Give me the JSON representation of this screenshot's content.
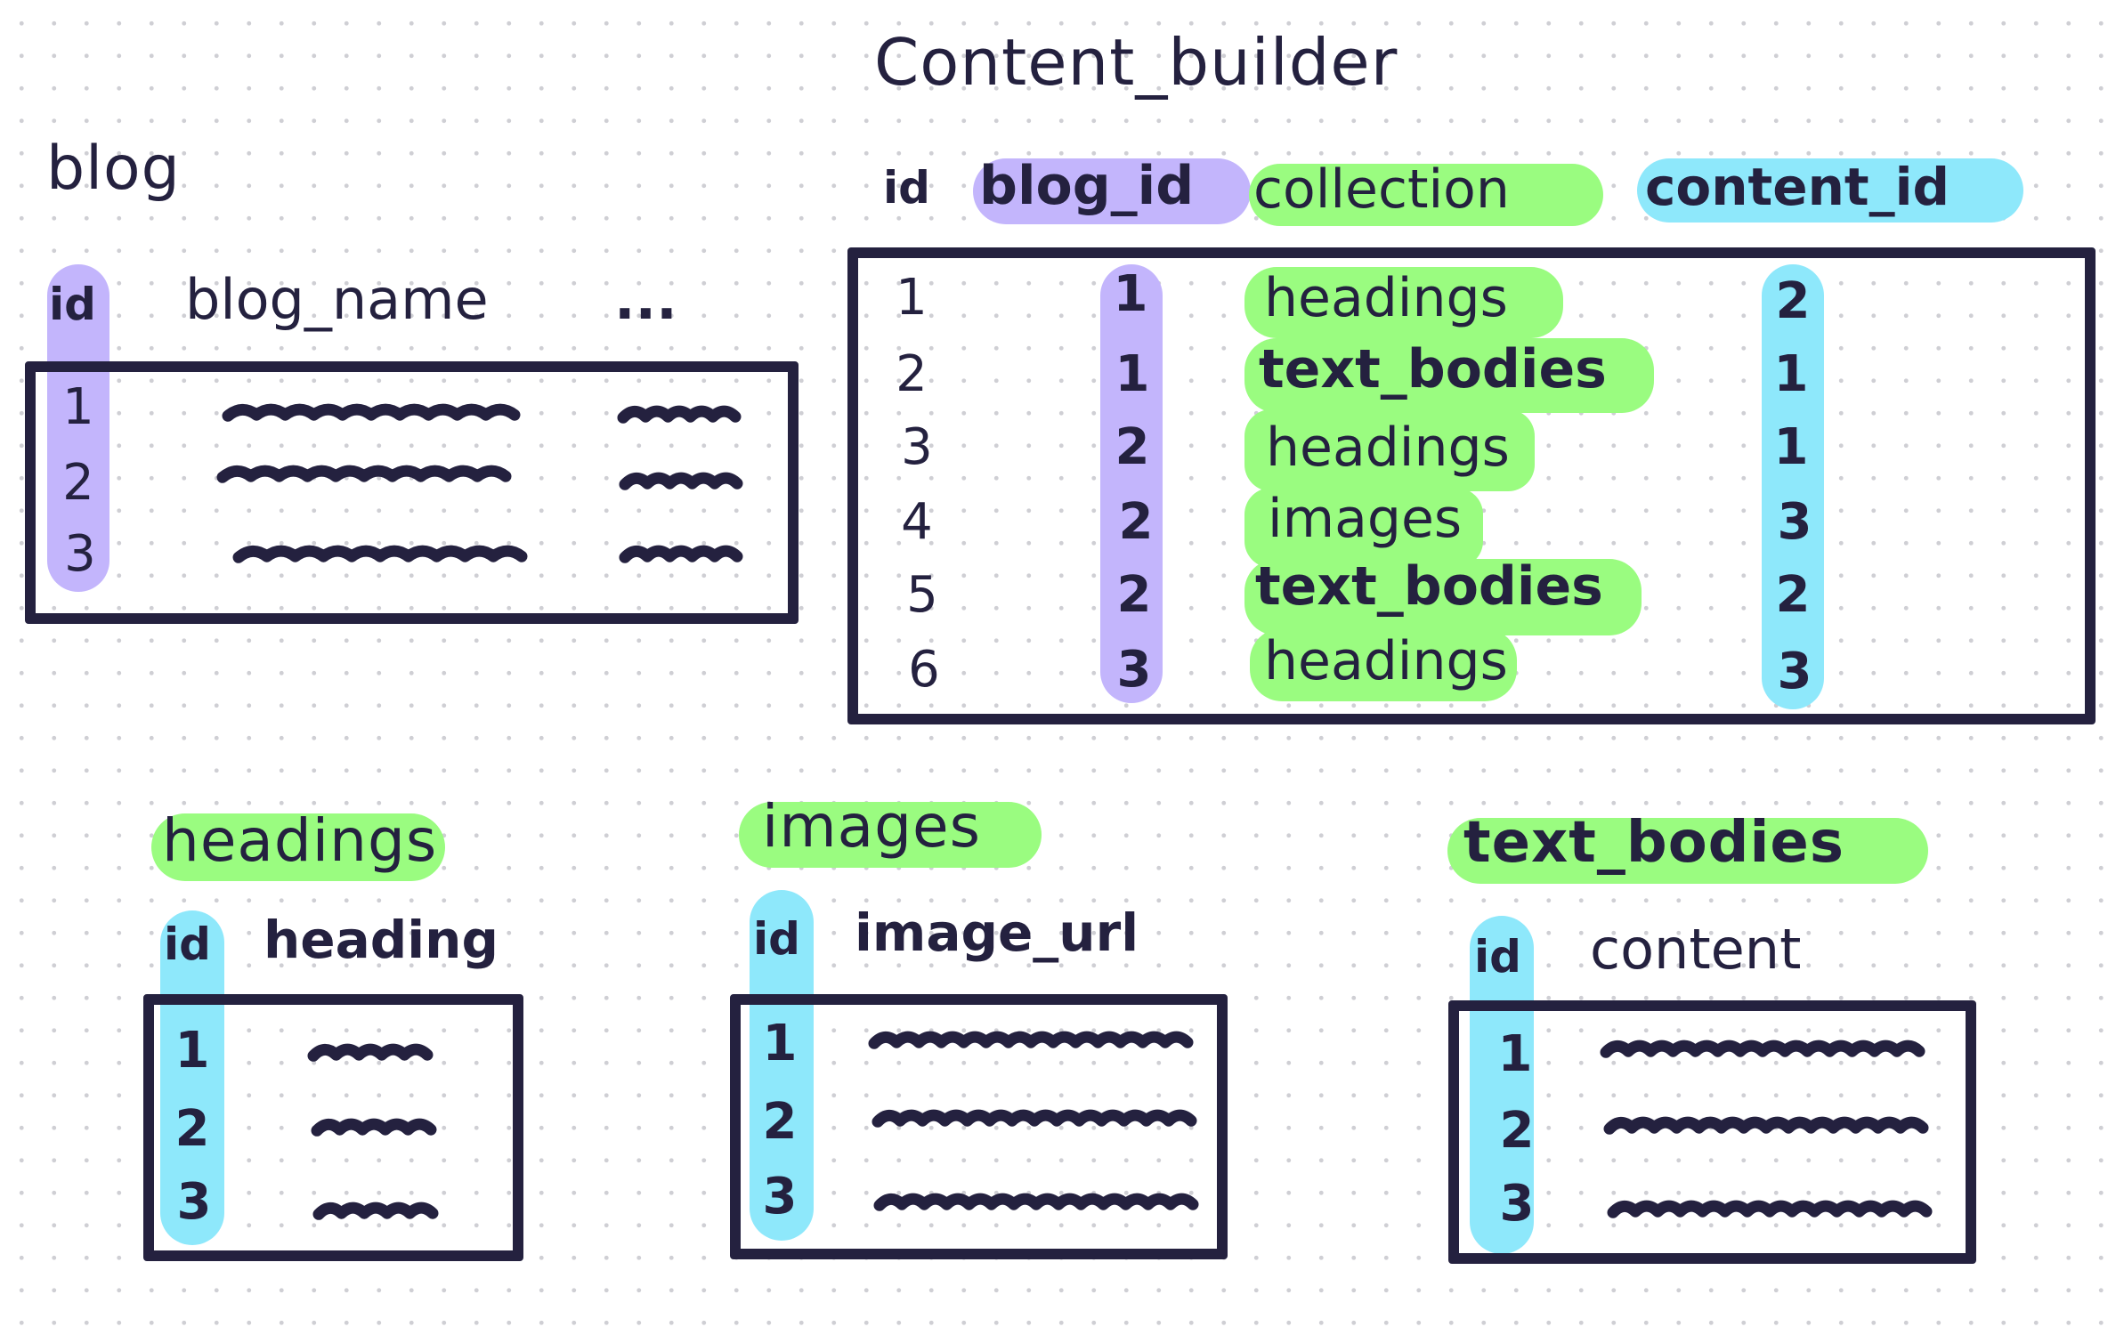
{
  "colors": {
    "ink": "#24213f",
    "foreign_key_blog": "#c3b5fc",
    "collection": "#9afc80",
    "content_id": "#8ee8fb"
  },
  "blog": {
    "title": "blog",
    "columns": [
      "id",
      "blog_name",
      "..."
    ],
    "rows": [
      {
        "id": "1",
        "blog_name": "redacted-scribble",
        "more": "redacted-scribble"
      },
      {
        "id": "2",
        "blog_name": "redacted-scribble",
        "more": "redacted-scribble"
      },
      {
        "id": "3",
        "blog_name": "redacted-scribble",
        "more": "redacted-scribble"
      }
    ]
  },
  "content_builder": {
    "title": "Content_builder",
    "columns": [
      "id",
      "blog_id",
      "collection",
      "content_id"
    ],
    "rows": [
      {
        "id": "1",
        "blog_id": "1",
        "collection": "headings",
        "content_id": "2"
      },
      {
        "id": "2",
        "blog_id": "1",
        "collection": "text_bodies",
        "content_id": "1"
      },
      {
        "id": "3",
        "blog_id": "2",
        "collection": "headings",
        "content_id": "1"
      },
      {
        "id": "4",
        "blog_id": "2",
        "collection": "images",
        "content_id": "3"
      },
      {
        "id": "5",
        "blog_id": "2",
        "collection": "text_bodies",
        "content_id": "2"
      },
      {
        "id": "6",
        "blog_id": "3",
        "collection": "headings",
        "content_id": "3"
      }
    ]
  },
  "headings": {
    "title": "headings",
    "columns": [
      "id",
      "heading"
    ],
    "rows": [
      {
        "id": "1",
        "heading": "redacted-scribble"
      },
      {
        "id": "2",
        "heading": "redacted-scribble"
      },
      {
        "id": "3",
        "heading": "redacted-scribble"
      }
    ]
  },
  "images": {
    "title": "images",
    "columns": [
      "id",
      "image_url"
    ],
    "rows": [
      {
        "id": "1",
        "image_url": "redacted-scribble"
      },
      {
        "id": "2",
        "image_url": "redacted-scribble"
      },
      {
        "id": "3",
        "image_url": "redacted-scribble"
      }
    ]
  },
  "text_bodies": {
    "title": "text_bodies",
    "columns": [
      "id",
      "content"
    ],
    "rows": [
      {
        "id": "1",
        "content": "redacted-scribble"
      },
      {
        "id": "2",
        "content": "redacted-scribble"
      },
      {
        "id": "3",
        "content": "redacted-scribble"
      }
    ]
  }
}
